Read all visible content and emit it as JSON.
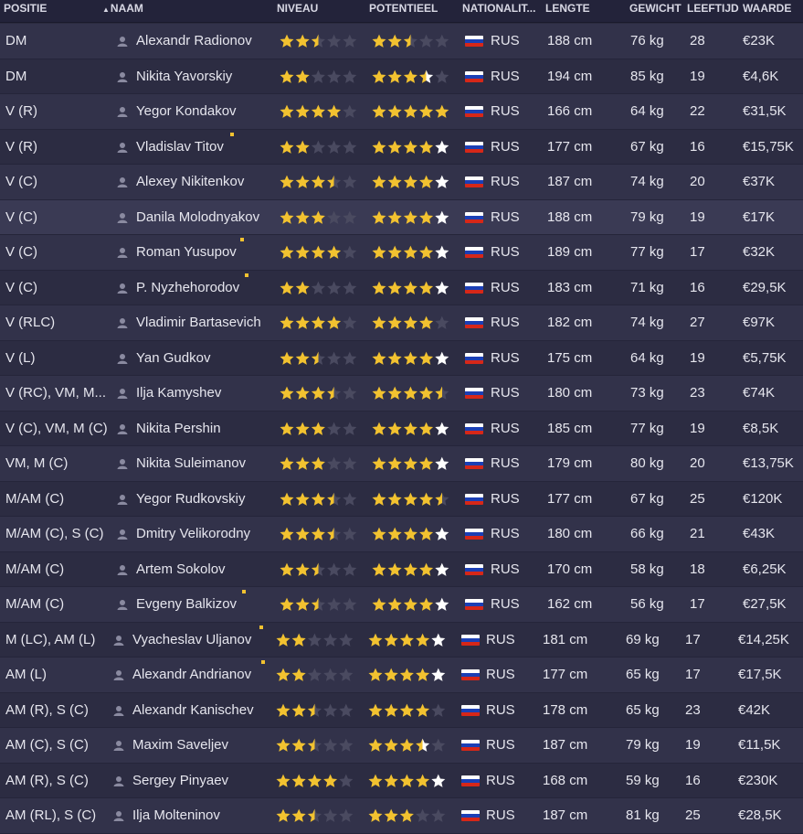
{
  "columns": {
    "positie": "POSITIE",
    "naam": "NAAM",
    "niveau": "NIVEAU",
    "potentieel": "POTENTIEEL",
    "nationaliteit": "NATIONALIT...",
    "lengte": "LENGTE",
    "gewicht": "GEWICHT",
    "leeftijd": "LEEFTIJD",
    "waarde": "WAARDE"
  },
  "icons": {
    "sort": "triangle-up-icon",
    "person": "person-icon",
    "flag": "russia-flag-icon",
    "star": "star-icon",
    "marker": "new-marker-icon"
  },
  "colors": {
    "star_gold": "#f2c230",
    "star_white": "#ffffff",
    "star_empty": "#4a4a60",
    "flag_white": "#ffffff",
    "flag_blue": "#1b3fb5",
    "flag_red": "#d62718"
  },
  "rows": [
    {
      "pos": "DM",
      "name": "Alexandr Radionov",
      "niveau": 2.5,
      "potentieel": 2.5,
      "nat": "RUS",
      "lengte": "188 cm",
      "gewicht": "76 kg",
      "leeftijd": "28",
      "waarde": "€23K",
      "marker": false
    },
    {
      "pos": "DM",
      "name": "Nikita Yavorskiy",
      "niveau": 2,
      "potentieel": 3.5,
      "pot_white": 1,
      "nat": "RUS",
      "lengte": "194 cm",
      "gewicht": "85 kg",
      "leeftijd": "19",
      "waarde": "€4,6K",
      "marker": false
    },
    {
      "pos": "V (R)",
      "name": "Yegor Kondakov",
      "niveau": 4,
      "potentieel": 5,
      "nat": "RUS",
      "lengte": "166 cm",
      "gewicht": "64 kg",
      "leeftijd": "22",
      "waarde": "€31,5K",
      "marker": false
    },
    {
      "pos": "V (R)",
      "name": "Vladislav Titov",
      "niveau": 2,
      "potentieel": 4,
      "pot_white": 1,
      "nat": "RUS",
      "lengte": "177 cm",
      "gewicht": "67 kg",
      "leeftijd": "16",
      "waarde": "€15,75K",
      "marker": true
    },
    {
      "pos": "V (C)",
      "name": "Alexey Nikitenkov",
      "niveau": 3.5,
      "potentieel": 4,
      "pot_white": 1,
      "nat": "RUS",
      "lengte": "187 cm",
      "gewicht": "74 kg",
      "leeftijd": "20",
      "waarde": "€37K",
      "marker": false
    },
    {
      "pos": "V (C)",
      "name": "Danila Molodnyakov",
      "niveau": 3,
      "potentieel": 4,
      "pot_white": 1,
      "nat": "RUS",
      "lengte": "188 cm",
      "gewicht": "79 kg",
      "leeftijd": "19",
      "waarde": "€17K",
      "marker": false
    },
    {
      "pos": "V (C)",
      "name": "Roman Yusupov",
      "niveau": 4,
      "potentieel": 4,
      "pot_white": 1,
      "nat": "RUS",
      "lengte": "189 cm",
      "gewicht": "77 kg",
      "leeftijd": "17",
      "waarde": "€32K",
      "marker": true
    },
    {
      "pos": "V (C)",
      "name": "P. Nyzhehorodov",
      "niveau": 2,
      "potentieel": 4,
      "pot_white": 1,
      "nat": "RUS",
      "lengte": "183 cm",
      "gewicht": "71 kg",
      "leeftijd": "16",
      "waarde": "€29,5K",
      "marker": true
    },
    {
      "pos": "V (RLC)",
      "name": "Vladimir Bartasevich",
      "niveau": 4,
      "potentieel": 4,
      "nat": "RUS",
      "lengte": "182 cm",
      "gewicht": "74 kg",
      "leeftijd": "27",
      "waarde": "€97K",
      "marker": false
    },
    {
      "pos": "V (L)",
      "name": "Yan Gudkov",
      "niveau": 2.5,
      "potentieel": 4,
      "pot_white": 1,
      "nat": "RUS",
      "lengte": "175 cm",
      "gewicht": "64 kg",
      "leeftijd": "19",
      "waarde": "€5,75K",
      "marker": false
    },
    {
      "pos": "V (RC), VM, M...",
      "name": "Ilja Kamyshev",
      "niveau": 3.5,
      "potentieel": 4.5,
      "nat": "RUS",
      "lengte": "180 cm",
      "gewicht": "73 kg",
      "leeftijd": "23",
      "waarde": "€74K",
      "marker": false
    },
    {
      "pos": "V (C), VM, M (C)",
      "name": "Nikita Pershin",
      "niveau": 3,
      "potentieel": 4,
      "pot_white": 1,
      "nat": "RUS",
      "lengte": "185 cm",
      "gewicht": "77 kg",
      "leeftijd": "19",
      "waarde": "€8,5K",
      "marker": false
    },
    {
      "pos": "VM, M (C)",
      "name": "Nikita Suleimanov",
      "niveau": 3,
      "potentieel": 4,
      "pot_white": 1,
      "nat": "RUS",
      "lengte": "179 cm",
      "gewicht": "80 kg",
      "leeftijd": "20",
      "waarde": "€13,75K",
      "marker": false
    },
    {
      "pos": "M/AM (C)",
      "name": "Yegor Rudkovskiy",
      "niveau": 3.5,
      "potentieel": 4.5,
      "nat": "RUS",
      "lengte": "177 cm",
      "gewicht": "67 kg",
      "leeftijd": "25",
      "waarde": "€120K",
      "marker": false
    },
    {
      "pos": "M/AM (C), S (C)",
      "name": "Dmitry Velikorodny",
      "niveau": 3.5,
      "potentieel": 4,
      "pot_white": 1,
      "nat": "RUS",
      "lengte": "180 cm",
      "gewicht": "66 kg",
      "leeftijd": "21",
      "waarde": "€43K",
      "marker": false
    },
    {
      "pos": "M/AM (C)",
      "name": "Artem Sokolov",
      "niveau": 2.5,
      "potentieel": 4,
      "pot_white": 1,
      "nat": "RUS",
      "lengte": "170 cm",
      "gewicht": "58 kg",
      "leeftijd": "18",
      "waarde": "€6,25K",
      "marker": false
    },
    {
      "pos": "M/AM (C)",
      "name": "Evgeny Balkizov",
      "niveau": 2.5,
      "potentieel": 4,
      "pot_white": 1,
      "nat": "RUS",
      "lengte": "162 cm",
      "gewicht": "56 kg",
      "leeftijd": "17",
      "waarde": "€27,5K",
      "marker": true
    },
    {
      "pos": "M (LC), AM (L)",
      "name": "Vyacheslav Uljanov",
      "niveau": 2,
      "potentieel": 4,
      "pot_white": 1,
      "nat": "RUS",
      "lengte": "181 cm",
      "gewicht": "69 kg",
      "leeftijd": "17",
      "waarde": "€14,25K",
      "marker": true,
      "shift": true
    },
    {
      "pos": "AM (L)",
      "name": "Alexandr Andrianov",
      "niveau": 2,
      "potentieel": 4,
      "pot_white": 1,
      "nat": "RUS",
      "lengte": "177 cm",
      "gewicht": "65 kg",
      "leeftijd": "17",
      "waarde": "€17,5K",
      "marker": true,
      "shift": true
    },
    {
      "pos": "AM (R), S (C)",
      "name": "Alexandr Kanischev",
      "niveau": 2.5,
      "potentieel": 4,
      "nat": "RUS",
      "lengte": "178 cm",
      "gewicht": "65 kg",
      "leeftijd": "23",
      "waarde": "€42K",
      "marker": false,
      "shift": true
    },
    {
      "pos": "AM (C), S (C)",
      "name": "Maxim Saveljev",
      "niveau": 2.5,
      "potentieel": 3.5,
      "pot_white": 1,
      "nat": "RUS",
      "lengte": "187 cm",
      "gewicht": "79 kg",
      "leeftijd": "19",
      "waarde": "€11,5K",
      "marker": false,
      "shift": true
    },
    {
      "pos": "AM (R), S (C)",
      "name": "Sergey Pinyaev",
      "niveau": 4,
      "potentieel": 4,
      "pot_white": 1,
      "nat": "RUS",
      "lengte": "168 cm",
      "gewicht": "59 kg",
      "leeftijd": "16",
      "waarde": "€230K",
      "marker": false,
      "shift": true
    },
    {
      "pos": "AM (RL), S (C)",
      "name": "Ilja Molteninov",
      "niveau": 2.5,
      "potentieel": 3,
      "nat": "RUS",
      "lengte": "187 cm",
      "gewicht": "81 kg",
      "leeftijd": "25",
      "waarde": "€28,5K",
      "marker": false,
      "shift": true
    }
  ]
}
